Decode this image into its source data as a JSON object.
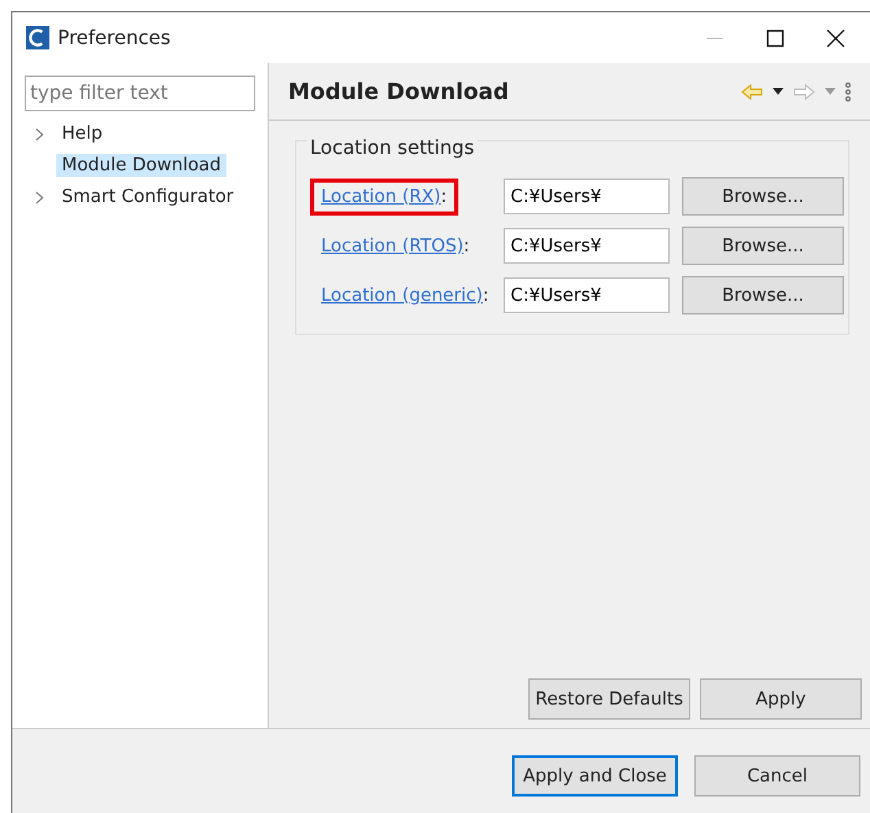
{
  "window": {
    "title": "Preferences"
  },
  "filter": {
    "placeholder": "type filter text"
  },
  "tree": [
    {
      "label": "Help",
      "expandable": true,
      "selected": false
    },
    {
      "label": "Module Download",
      "expandable": false,
      "selected": true
    },
    {
      "label": "Smart Configurator",
      "expandable": true,
      "selected": false
    }
  ],
  "page": {
    "title": "Module Download"
  },
  "group": {
    "title": "Location settings",
    "rows": [
      {
        "link": "Location (RX)",
        "colon": ":",
        "value": "C:¥Users¥",
        "button": "Browse...",
        "highlighted": true
      },
      {
        "link": "Location (RTOS)",
        "colon": ":",
        "value": "C:¥Users¥",
        "button": "Browse...",
        "highlighted": false
      },
      {
        "link": "Location (generic)",
        "colon": ":",
        "value": "C:¥Users¥",
        "button": "Browse...",
        "highlighted": false
      }
    ]
  },
  "page_buttons": [
    {
      "label": "Restore Defaults"
    },
    {
      "label": "Apply"
    }
  ],
  "dialog_buttons": [
    {
      "label": "Apply and Close",
      "default": true
    },
    {
      "label": "Cancel",
      "default": false
    }
  ]
}
